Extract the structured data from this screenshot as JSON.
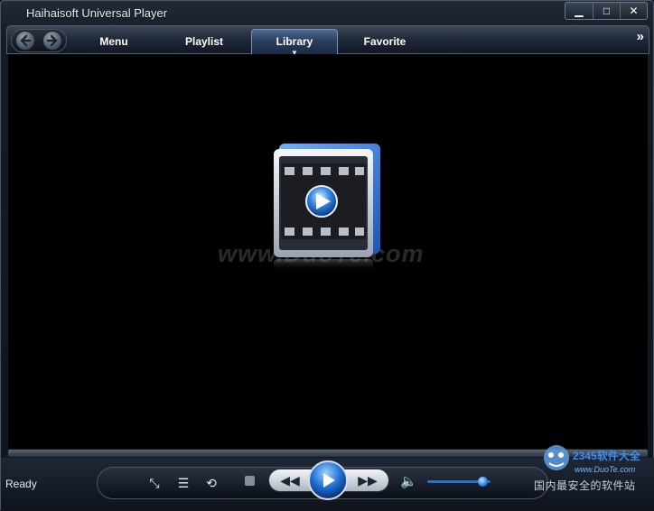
{
  "window": {
    "title": "Haihaisoft Universal Player",
    "controls": [
      {
        "name": "minimize",
        "glyph": "▁"
      },
      {
        "name": "maximize",
        "glyph": "□"
      },
      {
        "name": "close",
        "glyph": "✕"
      }
    ]
  },
  "toolbar": {
    "tabs": [
      {
        "label": "Menu",
        "active": false
      },
      {
        "label": "Playlist",
        "active": false
      },
      {
        "label": "Library",
        "active": true
      },
      {
        "label": "Favorite",
        "active": false
      }
    ],
    "more_glyph": "»",
    "active_caret": "▼"
  },
  "video": {
    "watermark": "www.DuoTe.com"
  },
  "status": {
    "text": "Ready"
  },
  "controls": {
    "mini_mode_glyph": "⤡",
    "playlist_glyph": "☰",
    "repeat_glyph": "⟲",
    "rewind_glyph": "◀◀",
    "forward_glyph": "▶▶",
    "volume_glyph": "🔈",
    "volume_level": 0.88
  },
  "overlay": {
    "logo_text": "2345软件大全",
    "logo_sub": "www.DuoTe.com",
    "caption": "国内最安全的软件站"
  },
  "colors": {
    "accent": "#1e6fd4",
    "tab_active": "#2b3f60"
  }
}
